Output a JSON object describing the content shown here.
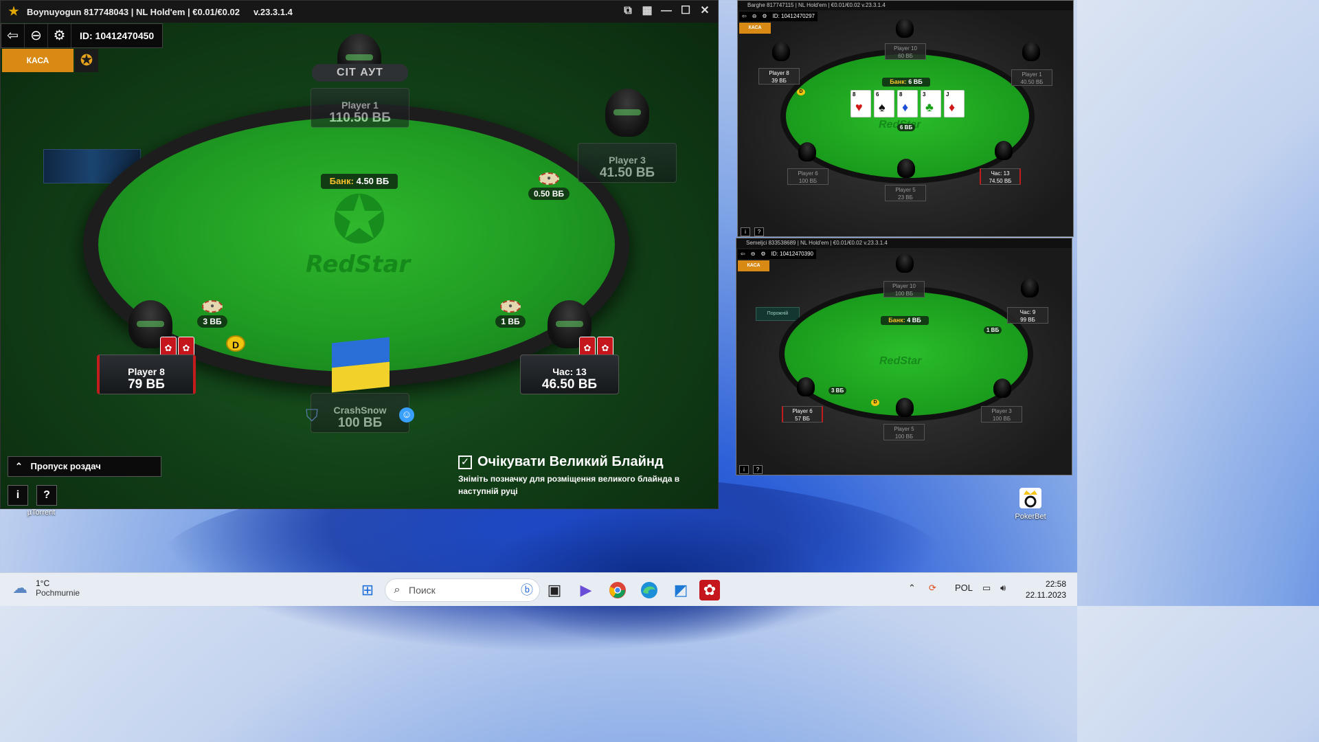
{
  "main_window": {
    "title": "Boynuyogun 817748043 | NL Hold'em | €0.01/€0.02",
    "version": "v.23.3.1.4",
    "table_id": "ID: 10412470450",
    "cashier_label": "КАСА",
    "pot_label": "Банк:",
    "pot_value": "4.50 ВБ",
    "brand": "RedStar",
    "sit_out_label": "СІТ АУТ",
    "seats": [
      {
        "name": "Player 1",
        "stack": "110.50 ВБ"
      },
      {
        "name": "Player 3",
        "stack": "41.50 ВБ"
      },
      {
        "name": "Player 8",
        "stack": "79 ВБ"
      },
      {
        "name": "Час: 13",
        "stack": "46.50 ВБ"
      },
      {
        "name": "CrashSnow",
        "stack": "100 ВБ"
      }
    ],
    "bets": {
      "player3": "0.50 ВБ",
      "player8": "3 ВБ",
      "hero_right": "1 ВБ"
    },
    "dealer_button": "D",
    "skip_hands_label": "Пропуск роздач",
    "wait_bb_title": "Очікувати Великий Блайнд",
    "wait_bb_desc": "Зніміть позначку для розміщення великого блайнда в наступній руці",
    "wait_bb_checked": true
  },
  "window2": {
    "title": "Barghe 817747115 | NL Hold'em | €0.01/€0.02    v.23.3.1.4",
    "table_id": "ID: 10412470297",
    "cashier_label": "КАСА",
    "pot_label": "Банк:",
    "pot_value": "6 ВБ",
    "brand": "RedStar",
    "board": [
      {
        "rank": "8",
        "suit": "♥",
        "color": "#d01818"
      },
      {
        "rank": "6",
        "suit": "♠",
        "color": "#111111"
      },
      {
        "rank": "8",
        "suit": "♦",
        "color": "#1e4fd8"
      },
      {
        "rank": "3",
        "suit": "♣",
        "color": "#18a018"
      },
      {
        "rank": "J",
        "suit": "♦",
        "color": "#d01818"
      }
    ],
    "seats": [
      {
        "name": "Player 10",
        "stack": "60 ВБ"
      },
      {
        "name": "Player 8",
        "stack": "39 ВБ"
      },
      {
        "name": "Player 1",
        "stack": "40.50 ВБ"
      },
      {
        "name": "Player 6",
        "stack": "100 ВБ"
      },
      {
        "name": "Player 5",
        "stack": "23 ВБ"
      },
      {
        "name": "Час: 13",
        "stack": "74.50 ВБ"
      }
    ],
    "bet": "6 ВБ"
  },
  "window3": {
    "title": "Semeljci 833538689 | NL Hold'em | €0.01/€0.02    v.23.3.1.4",
    "table_id": "ID: 10412470390",
    "cashier_label": "КАСА",
    "pot_label": "Банк:",
    "pot_value": "4 ВБ",
    "brand": "RedStar",
    "empty_seat_label": "Порожній",
    "seats": [
      {
        "name": "Player 10",
        "stack": "100 ВБ"
      },
      {
        "name": "Час: 9",
        "stack": "99 ВБ"
      },
      {
        "name": "Player 6",
        "stack": "57 ВБ"
      },
      {
        "name": "Player 5",
        "stack": "100 ВБ"
      },
      {
        "name": "Player 3",
        "stack": "100 ВБ"
      }
    ],
    "bets": {
      "right": "1 ВБ",
      "left": "3 ВБ"
    }
  },
  "desktop": {
    "icons": [
      {
        "label": "µTorrent"
      },
      {
        "label": "PokerBet"
      }
    ]
  },
  "taskbar": {
    "temperature": "1°C",
    "weather": "Pochmurnie",
    "search_placeholder": "Поиск",
    "language": "POL",
    "time": "22:58",
    "date": "22.11.2023"
  }
}
